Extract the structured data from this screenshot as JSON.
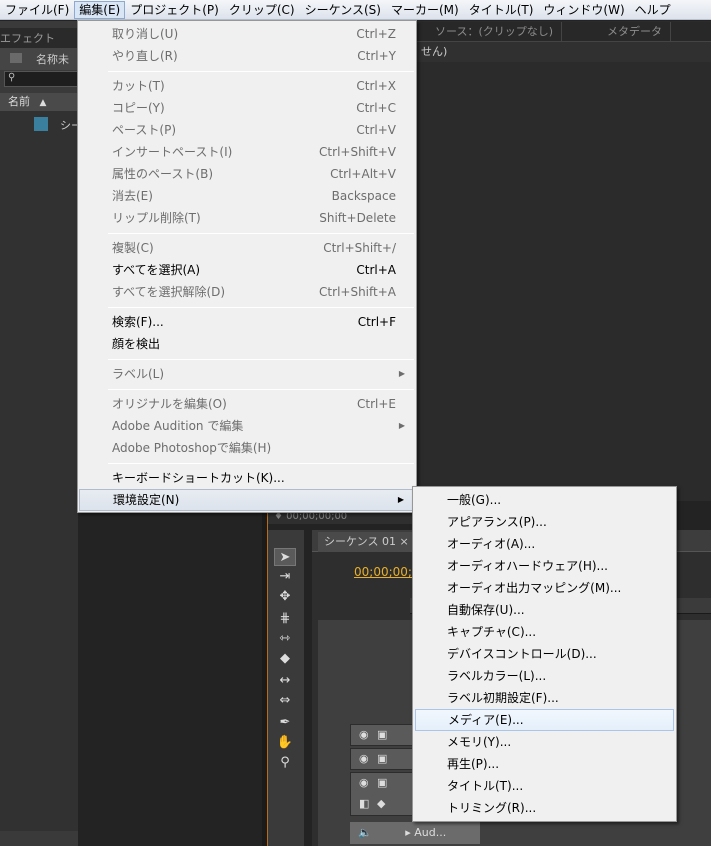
{
  "menubar": {
    "items": [
      "ファイル(F)",
      "編集(E)",
      "プロジェクト(P)",
      "クリップ(C)",
      "シーケンス(S)",
      "マーカー(M)",
      "タイトル(T)",
      "ウィンドウ(W)",
      "ヘルプ"
    ]
  },
  "project_panel": {
    "tab": "エフェクト",
    "title": "名称未",
    "column_name": "名前",
    "item": "シー"
  },
  "source_monitor": {
    "tabs": [
      "ソース：(クリップなし)",
      "メタデータ"
    ],
    "inner": "せん)"
  },
  "edit_menu": {
    "items": [
      {
        "label": "取り消し(U)",
        "shortcut": "Ctrl+Z"
      },
      {
        "label": "やり直し(R)",
        "shortcut": "Ctrl+Y"
      },
      {
        "label": "カット(T)",
        "shortcut": "Ctrl+X"
      },
      {
        "label": "コピー(Y)",
        "shortcut": "Ctrl+C"
      },
      {
        "label": "ペースト(P)",
        "shortcut": "Ctrl+V"
      },
      {
        "label": "インサートペースト(I)",
        "shortcut": "Ctrl+Shift+V"
      },
      {
        "label": "属性のペースト(B)",
        "shortcut": "Ctrl+Alt+V"
      },
      {
        "label": "消去(E)",
        "shortcut": "Backspace"
      },
      {
        "label": "リップル削除(T)",
        "shortcut": "Shift+Delete"
      },
      {
        "label": "複製(C)",
        "shortcut": "Ctrl+Shift+/"
      },
      {
        "label": "すべてを選択(A)",
        "shortcut": "Ctrl+A"
      },
      {
        "label": "すべてを選択解除(D)",
        "shortcut": "Ctrl+Shift+A"
      },
      {
        "label": "検索(F)...",
        "shortcut": "Ctrl+F"
      },
      {
        "label": "顔を検出",
        "shortcut": ""
      },
      {
        "label": "ラベル(L)",
        "shortcut": ""
      },
      {
        "label": "オリジナルを編集(O)",
        "shortcut": "Ctrl+E"
      },
      {
        "label": "Adobe Audition で編集",
        "shortcut": ""
      },
      {
        "label": "Adobe Photoshopで編集(H)",
        "shortcut": ""
      },
      {
        "label": "キーボードショートカット(K)...",
        "shortcut": ""
      },
      {
        "label": "環境設定(N)",
        "shortcut": ""
      }
    ]
  },
  "preferences_submenu": {
    "items": [
      "一般(G)...",
      "アピアランス(P)...",
      "オーディオ(A)...",
      "オーディオハードウェア(H)...",
      "オーディオ出力マッピング(M)...",
      "自動保存(U)...",
      "キャプチャ(C)...",
      "デバイスコントロール(D)...",
      "ラベルカラー(L)...",
      "ラベル初期設定(F)...",
      "メディア(E)...",
      "メモリ(Y)...",
      "再生(P)...",
      "タイトル(T)...",
      "トリミング(R)..."
    ]
  },
  "timeline": {
    "position": "00;00;00;00",
    "tab": "シーケンス 01",
    "timecode": "00;00;00;0",
    "audio_track": "Aud..."
  },
  "colors": {
    "timecode": "#e8b02a",
    "panel_accent": "#b86e14"
  }
}
